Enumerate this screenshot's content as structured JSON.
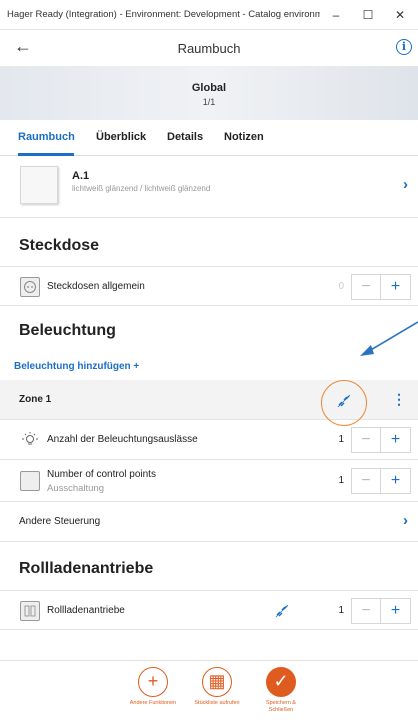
{
  "window": {
    "title": "Hager Ready (Integration) - Environment: Development - Catalog environment: Prod...",
    "minimize": "–",
    "maximize": "☐",
    "close": "✕"
  },
  "appbar": {
    "back": "←",
    "title": "Raumbuch",
    "info": "i"
  },
  "banner": {
    "name": "Global",
    "page": "1/1"
  },
  "tabs": [
    {
      "label": "Raumbuch"
    },
    {
      "label": "Überblick"
    },
    {
      "label": "Details"
    },
    {
      "label": "Notizen"
    }
  ],
  "product": {
    "name": "A.1",
    "description": "lichtweiß glänzend / lichtweiß glänzend",
    "chevron": "›"
  },
  "sections": {
    "steckdose": {
      "title": "Steckdose",
      "rows": [
        {
          "label": "Steckdosen allgemein",
          "qty": "0"
        }
      ]
    },
    "beleuchtung": {
      "title": "Beleuchtung",
      "add_link": "Beleuchtung hinzufügen +",
      "zone": {
        "label": "Zone 1",
        "menu": "⋮"
      },
      "rows": [
        {
          "label": "Anzahl der Beleuchtungsauslässe",
          "qty": "1"
        },
        {
          "label": "Number of control points",
          "sub": "Ausschaltung",
          "qty": "1"
        }
      ],
      "other": {
        "label": "Andere Steuerung",
        "chevron": "›"
      }
    },
    "rollladen": {
      "title": "Rollladenantriebe",
      "rows": [
        {
          "label": "Rollladenantriebe",
          "qty": "1"
        }
      ]
    }
  },
  "stepper": {
    "minus": "−",
    "plus": "+"
  },
  "bottom_actions": [
    {
      "icon": "+",
      "label": "Andere Funktionen"
    },
    {
      "icon": "▦",
      "label": "Stückliste aufrufen"
    },
    {
      "icon": "✓",
      "label": "Speichern & Schließen"
    }
  ],
  "colors": {
    "accent": "#1b6fc4",
    "action": "#e05b20",
    "highlight": "#f08a3c"
  }
}
